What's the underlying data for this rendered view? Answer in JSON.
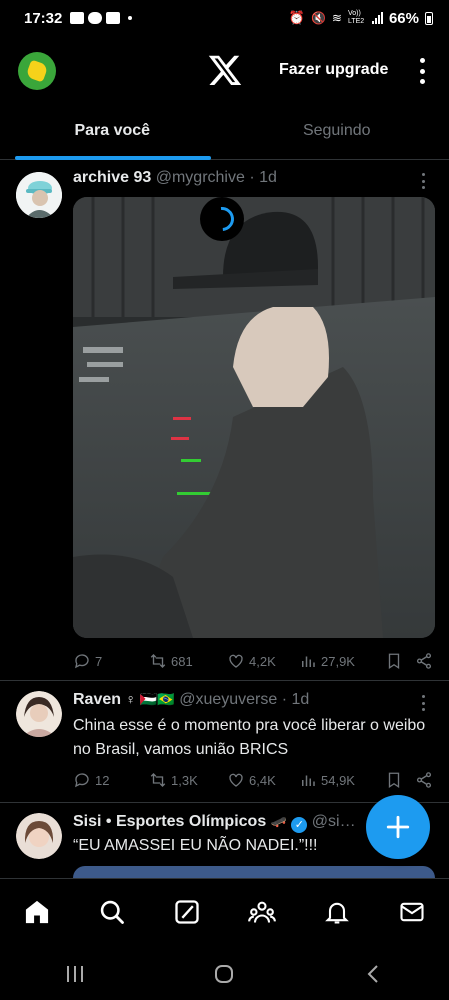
{
  "status_bar": {
    "time": "17:32",
    "battery": "66%",
    "network": "Vo)) LTE2"
  },
  "header": {
    "upgrade_label": "Fazer upgrade",
    "logo_icon": "x-logo-icon"
  },
  "tabs": [
    {
      "label": "Para você",
      "active": true
    },
    {
      "label": "Seguindo",
      "active": false
    }
  ],
  "tweets": [
    {
      "name": "archive 93",
      "handle": "@mygrchive",
      "time": "· 1d",
      "replies": "7",
      "retweets": "681",
      "likes": "4,2K",
      "views": "27,9K"
    },
    {
      "name": "Raven",
      "name_suffix": "♀ 🇵🇸🇧🇷",
      "handle": "@xueyuverse",
      "time": "· 1d",
      "text": "China esse é o momento pra você liberar o weibo no Brasil, vamos união BRICS",
      "replies": "12",
      "retweets": "1,3K",
      "likes": "6,4K",
      "views": "54,9K"
    },
    {
      "name": "Sisi • Esportes Olímpicos",
      "handle": "@si…",
      "text": "“EU AMASSEI EU NÃO NADEI.”!!!"
    }
  ],
  "colors": {
    "accent": "#1d9bf0",
    "background": "#000000",
    "text": "#e7e9ea",
    "muted": "#71767b",
    "divider": "#2f3336"
  }
}
